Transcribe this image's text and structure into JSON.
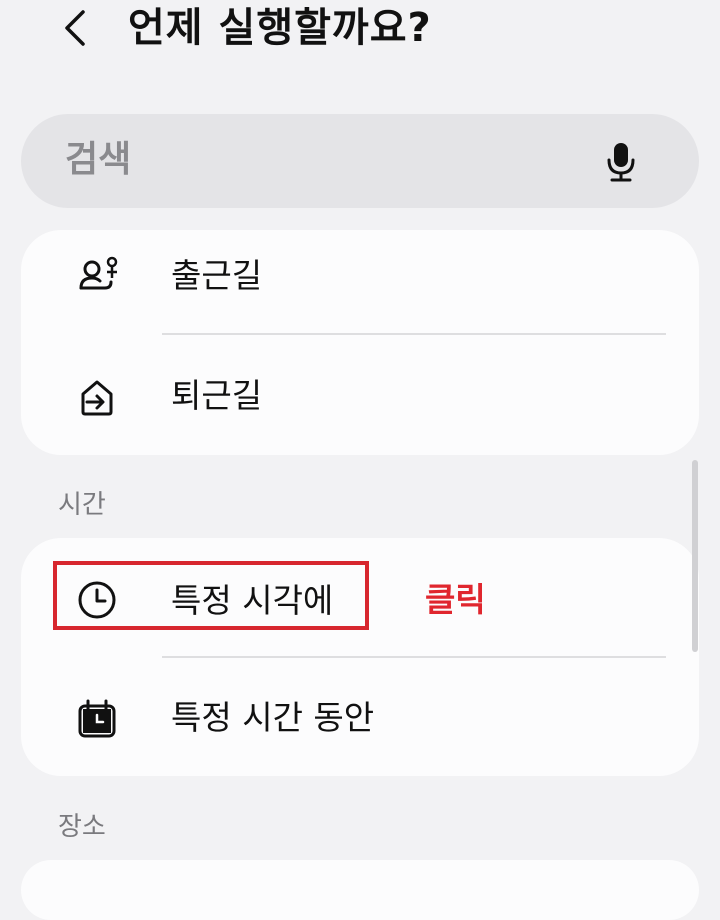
{
  "header": {
    "back_icon": "chevron-left-icon",
    "title": "언제 실행할까요?"
  },
  "search": {
    "placeholder": "검색",
    "mic_icon": "microphone-icon"
  },
  "commute_group": {
    "items": [
      {
        "label": "출근길",
        "icon": "commute-person-icon"
      },
      {
        "label": "퇴근길",
        "icon": "home-arrow-icon"
      }
    ]
  },
  "time_section": {
    "label": "시간",
    "items": [
      {
        "label": "특정 시각에",
        "icon": "clock-icon"
      },
      {
        "label": "특정 시간 동안",
        "icon": "calendar-clock-icon"
      }
    ]
  },
  "place_section": {
    "label": "장소"
  },
  "annotation": {
    "text": "클릭",
    "color": "#e0262e"
  },
  "colors": {
    "background": "#f2f2f4",
    "card": "#fcfcfd",
    "search_bg": "#e4e4e7",
    "highlight": "#d7262e"
  }
}
